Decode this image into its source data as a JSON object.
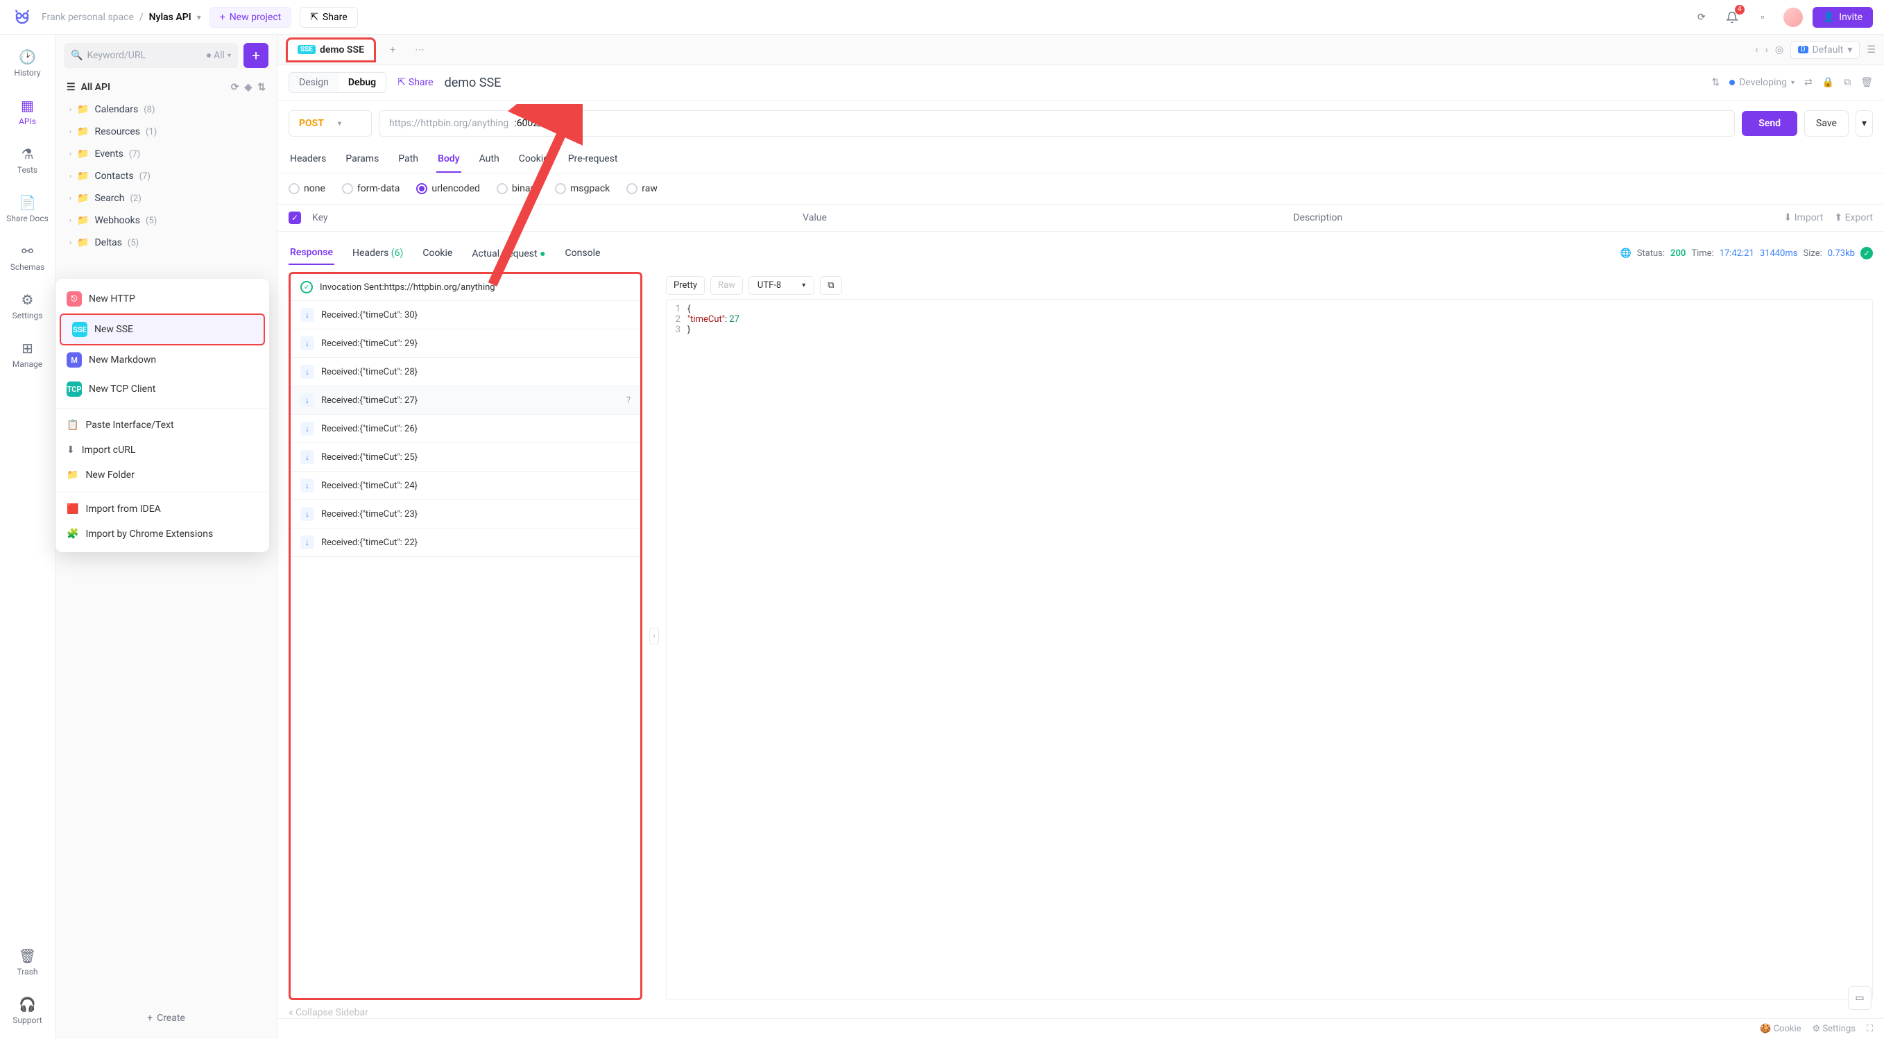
{
  "header": {
    "workspace": "Frank personal space",
    "project": "Nylas API",
    "new_project": "New project",
    "share": "Share",
    "invite": "Invite",
    "notification_count": "4"
  },
  "nav": {
    "history": "History",
    "apis": "APIs",
    "tests": "Tests",
    "share_docs": "Share Docs",
    "schemas": "Schemas",
    "settings": "Settings",
    "manage": "Manage",
    "trash": "Trash",
    "support": "Support"
  },
  "sidebar": {
    "search_placeholder": "Keyword/URL",
    "filter_label": "All",
    "all_api": "All API",
    "items": [
      {
        "label": "Calendars",
        "count": "(8)"
      },
      {
        "label": "Resources",
        "count": "(1)"
      },
      {
        "label": "Events",
        "count": "(7)"
      },
      {
        "label": "Contacts",
        "count": "(7)"
      },
      {
        "label": "Search",
        "count": "(2)"
      },
      {
        "label": "Webhooks",
        "count": "(5)"
      },
      {
        "label": "Deltas",
        "count": "(5)"
      }
    ],
    "create": "Create"
  },
  "context_menu": {
    "new_http": "New HTTP",
    "new_sse": "New SSE",
    "new_markdown": "New Markdown",
    "new_tcp": "New TCP Client",
    "paste": "Paste Interface/Text",
    "import_curl": "Import cURL",
    "new_folder": "New Folder",
    "import_idea": "Import from IDEA",
    "import_chrome": "Import by Chrome Extensions"
  },
  "tabs": {
    "active_badge": "SSE",
    "active_name": "demo SSE",
    "env_label": "Default"
  },
  "sub": {
    "design": "Design",
    "debug": "Debug",
    "share": "Share",
    "title": "demo SSE",
    "status": "Developing"
  },
  "request": {
    "method": "POST",
    "url_base": "https://httpbin.org/anything",
    "url_path": ":6002/sse",
    "send": "Send",
    "save": "Save",
    "tabs": [
      "Headers",
      "Params",
      "Path",
      "Body",
      "Auth",
      "Cookie",
      "Pre-request"
    ],
    "body_types": [
      "none",
      "form-data",
      "urlencoded",
      "binary",
      "msgpack",
      "raw"
    ],
    "kv": {
      "key": "Key",
      "value": "Value",
      "desc": "Description",
      "import": "Import",
      "export": "Export"
    }
  },
  "response": {
    "tabs": {
      "response": "Response",
      "headers": "Headers",
      "headers_count": "(6)",
      "cookie": "Cookie",
      "actual": "Actual Request",
      "console": "Console"
    },
    "meta": {
      "status_label": "Status:",
      "status": "200",
      "time_label": "Time:",
      "time": "17:42:21",
      "duration": "31440ms",
      "size_label": "Size:",
      "size": "0.73kb"
    },
    "events": [
      {
        "type": "ok",
        "text": "Invocation Sent:https://httpbin.org/anything"
      },
      {
        "type": "dl",
        "text": "Received:{\"timeCut\": 30}"
      },
      {
        "type": "dl",
        "text": "Received:{\"timeCut\": 29}"
      },
      {
        "type": "dl",
        "text": "Received:{\"timeCut\": 28}"
      },
      {
        "type": "dl",
        "text": "Received:{\"timeCut\": 27}",
        "selected": true
      },
      {
        "type": "dl",
        "text": "Received:{\"timeCut\": 26}"
      },
      {
        "type": "dl",
        "text": "Received:{\"timeCut\": 25}"
      },
      {
        "type": "dl",
        "text": "Received:{\"timeCut\": 24}"
      },
      {
        "type": "dl",
        "text": "Received:{\"timeCut\": 23}"
      },
      {
        "type": "dl",
        "text": "Received:{\"timeCut\": 22}"
      }
    ],
    "json_toolbar": {
      "pretty": "Pretty",
      "raw": "Raw",
      "encoding": "UTF-8"
    },
    "json_lines": [
      {
        "n": "1",
        "content": "{"
      },
      {
        "n": "2",
        "key": "\"timeCut\"",
        "sep": ": ",
        "val": "27"
      },
      {
        "n": "3",
        "content": "}"
      }
    ],
    "collapse": "Collapse Sidebar"
  },
  "footer": {
    "cookie": "Cookie",
    "settings": "Settings"
  }
}
